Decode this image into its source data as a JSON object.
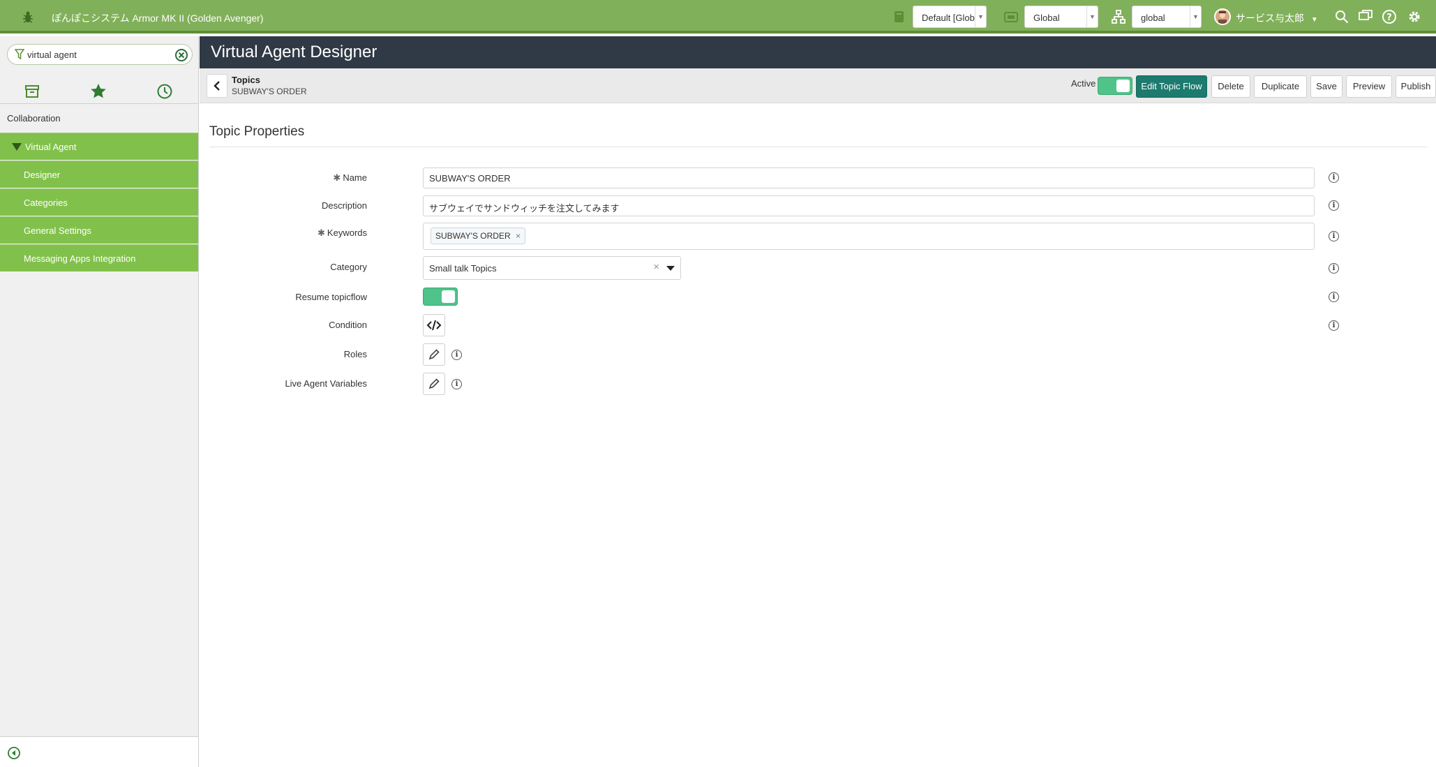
{
  "topbar": {
    "title": "ぽんぽこシステム Armor MK II (Golden Avenger)",
    "update_set": "Default [Glob",
    "domain": "Global",
    "scope": "global",
    "user_name": "サービス与太郎"
  },
  "sidebar": {
    "filter_value": "virtual agent",
    "section": "Collaboration",
    "items": [
      {
        "label": "Virtual Agent"
      },
      {
        "label": "Designer"
      },
      {
        "label": "Categories"
      },
      {
        "label": "General Settings"
      },
      {
        "label": "Messaging Apps Integration"
      }
    ]
  },
  "header": {
    "title": "Virtual Agent Designer"
  },
  "subbar": {
    "breadcrumb_parent": "Topics",
    "breadcrumb_current": "SUBWAY'S ORDER",
    "active_label": "Active",
    "active_on": true,
    "buttons": {
      "edit_flow": "Edit Topic Flow",
      "delete": "Delete",
      "duplicate": "Duplicate",
      "save": "Save",
      "preview": "Preview",
      "publish": "Publish"
    }
  },
  "form": {
    "section_title": "Topic Properties",
    "labels": {
      "name": "Name",
      "description": "Description",
      "keywords": "Keywords",
      "category": "Category",
      "resume": "Resume topicflow",
      "condition": "Condition",
      "roles": "Roles",
      "live_agent": "Live Agent Variables"
    },
    "values": {
      "name": "SUBWAY'S ORDER",
      "description": "サブウェイでサンドウィッチを注文してみます",
      "keyword_tag": "SUBWAY'S ORDER",
      "category": "Small talk Topics",
      "resume_on": true
    }
  },
  "colors": {
    "topbar": "#81b05a",
    "nav_active": "#81c14b",
    "header": "#303a46",
    "primary_button": "#1d7a6f",
    "toggle_on": "#4fc38a"
  }
}
